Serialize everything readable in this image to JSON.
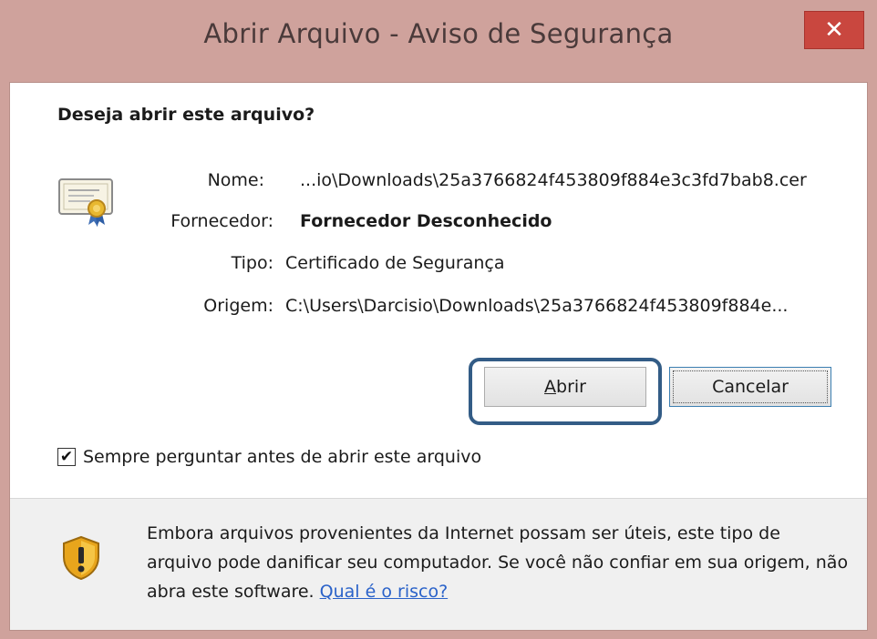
{
  "window": {
    "title": "Abrir Arquivo - Aviso de Segurança",
    "close_glyph": "✕"
  },
  "dialog": {
    "question": "Deseja abrir este arquivo?",
    "icon": "certificate-icon",
    "fields": {
      "name_label": "Nome:",
      "name_value": "...io\\Downloads\\25a3766824f453809f884e3c3fd7bab8.cer",
      "publisher_label": "Fornecedor:",
      "publisher_value": "Fornecedor Desconhecido",
      "type_label": "Tipo:",
      "type_value": "Certificado de Segurança",
      "origin_label": "Origem:",
      "origin_value": "C:\\Users\\Darcisio\\Downloads\\25a3766824f453809f884e..."
    },
    "buttons": {
      "open": "Abrir",
      "cancel": "Cancelar"
    },
    "checkbox": {
      "label": "Sempre perguntar antes de abrir este arquivo",
      "checked": true,
      "check_glyph": "✔"
    }
  },
  "footer": {
    "icon": "shield-warning-icon",
    "warning_text": "Embora arquivos provenientes da Internet possam ser úteis, este tipo de arquivo pode danificar seu computador. Se você não confiar em sua origem, não abra este software.",
    "risk_link": "Qual é o risco?"
  },
  "colors": {
    "titlebar": "#cfa29c",
    "close_button": "#c9473f",
    "focus_ring": "#335c86",
    "link": "#2a62c9"
  }
}
